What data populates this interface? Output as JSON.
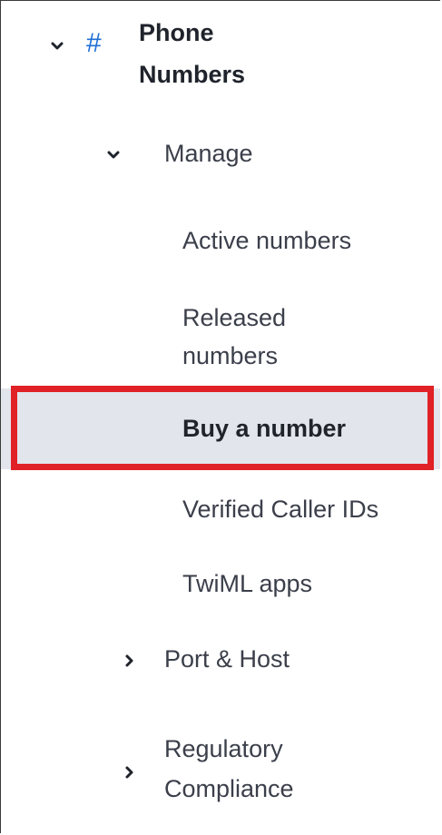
{
  "section": {
    "icon": "hash-icon",
    "title_line1": "Phone",
    "title_line2": "Numbers",
    "expanded": true
  },
  "groups": {
    "manage": {
      "label": "Manage",
      "expanded": true,
      "items": [
        {
          "label": "Active numbers"
        },
        {
          "label_line1": "Released",
          "label_line2": "numbers"
        },
        {
          "label": "Buy a number",
          "selected": true
        },
        {
          "label": "Verified Caller IDs"
        },
        {
          "label": "TwiML apps"
        }
      ]
    },
    "port_host": {
      "label": "Port & Host",
      "expanded": false
    },
    "regulatory": {
      "label_line1": "Regulatory",
      "label_line2": "Compliance",
      "expanded": false
    }
  },
  "colors": {
    "highlight": "#e02125",
    "selected_bg": "#e2e5ec",
    "icon_blue": "#1f6fd6"
  }
}
